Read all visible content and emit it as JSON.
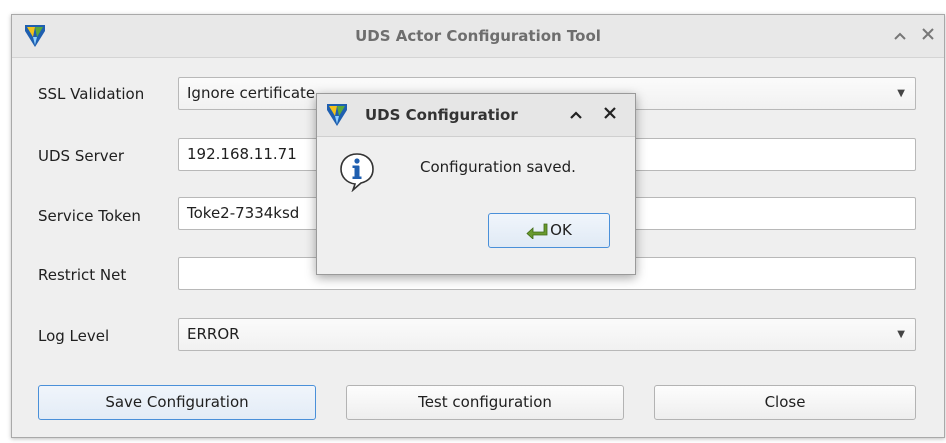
{
  "window": {
    "title": "UDS Actor Configuration Tool",
    "controls": {
      "minimize_glyph": "⌃",
      "close_glyph": "✕"
    }
  },
  "form": {
    "ssl_validation": {
      "label": "SSL Validation",
      "value": "Ignore certificate"
    },
    "uds_server": {
      "label": "UDS Server",
      "value": "192.168.11.71"
    },
    "service_token": {
      "label": "Service Token",
      "value": "Toke2-7334ksd"
    },
    "restrict_net": {
      "label": "Restrict Net",
      "value": ""
    },
    "log_level": {
      "label": "Log Level",
      "value": "ERROR"
    }
  },
  "buttons": {
    "save": "Save Configuration",
    "test": "Test configuration",
    "close": "Close"
  },
  "dialog": {
    "title": "UDS Configuratior",
    "message": "Configuration saved.",
    "ok_label": "OK",
    "icon": "info-icon"
  },
  "colors": {
    "accent": "#4a90d9",
    "logo_blue": "#1f5fb0",
    "logo_yellow": "#f3c21a",
    "logo_green": "#5aa83a"
  }
}
